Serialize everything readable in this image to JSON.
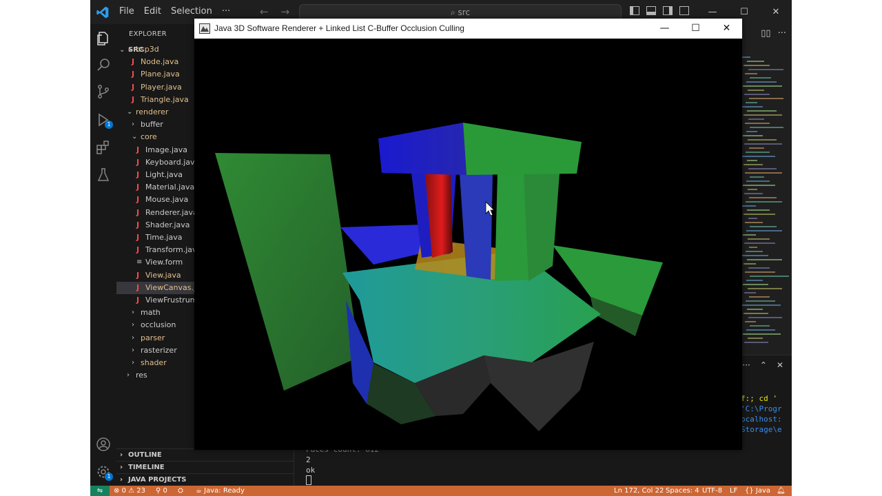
{
  "vscode": {
    "menu": [
      "File",
      "Edit",
      "Selection",
      "···"
    ],
    "search_text": "src",
    "explorer_title": "EXPLORER",
    "folder_root": "SRC",
    "tree": [
      {
        "label": "bsp3d",
        "type": "folder",
        "depth": 1,
        "open": true,
        "status": "mod"
      },
      {
        "label": "Node.java",
        "type": "java",
        "depth": 2,
        "status": "mod"
      },
      {
        "label": "Plane.java",
        "type": "java",
        "depth": 2,
        "status": "mod"
      },
      {
        "label": "Player.java",
        "type": "java",
        "depth": 2,
        "status": "mod"
      },
      {
        "label": "Triangle.java",
        "type": "java",
        "depth": 2,
        "status": "mod"
      },
      {
        "label": "renderer",
        "type": "folder",
        "depth": 1,
        "open": true,
        "status": "mod"
      },
      {
        "label": "buffer",
        "type": "folder",
        "depth": 2,
        "open": false,
        "status": ""
      },
      {
        "label": "core",
        "type": "folder",
        "depth": 2,
        "open": true,
        "status": "mod"
      },
      {
        "label": "Image.java",
        "type": "java",
        "depth": 3,
        "status": ""
      },
      {
        "label": "Keyboard.java",
        "type": "java",
        "depth": 3,
        "status": ""
      },
      {
        "label": "Light.java",
        "type": "java",
        "depth": 3,
        "status": ""
      },
      {
        "label": "Material.java",
        "type": "java",
        "depth": 3,
        "status": ""
      },
      {
        "label": "Mouse.java",
        "type": "java",
        "depth": 3,
        "status": ""
      },
      {
        "label": "Renderer.java",
        "type": "java",
        "depth": 3,
        "status": ""
      },
      {
        "label": "Shader.java",
        "type": "java",
        "depth": 3,
        "status": ""
      },
      {
        "label": "Time.java",
        "type": "java",
        "depth": 3,
        "status": ""
      },
      {
        "label": "Transform.java",
        "type": "java",
        "depth": 3,
        "status": ""
      },
      {
        "label": "View.form",
        "type": "form",
        "depth": 3,
        "status": ""
      },
      {
        "label": "View.java",
        "type": "java",
        "depth": 3,
        "status": "mod"
      },
      {
        "label": "ViewCanvas.java",
        "type": "java",
        "depth": 3,
        "status": "mod",
        "selected": true
      },
      {
        "label": "ViewFrustrumC",
        "type": "java",
        "depth": 3,
        "status": ""
      },
      {
        "label": "math",
        "type": "folder",
        "depth": 2,
        "open": false,
        "status": ""
      },
      {
        "label": "occlusion",
        "type": "folder",
        "depth": 2,
        "open": false,
        "status": ""
      },
      {
        "label": "parser",
        "type": "folder",
        "depth": 2,
        "open": false,
        "status": "mod"
      },
      {
        "label": "rasterizer",
        "type": "folder",
        "depth": 2,
        "open": false,
        "status": ""
      },
      {
        "label": "shader",
        "type": "folder",
        "depth": 2,
        "open": false,
        "status": "mod"
      },
      {
        "label": "res",
        "type": "folder",
        "depth": 1,
        "open": false,
        "status": ""
      }
    ],
    "sections": [
      "OUTLINE",
      "TIMELINE",
      "JAVA PROJECTS"
    ],
    "terminal": {
      "lines": [
        "Faces count: 612",
        "2",
        "ok"
      ],
      "side_lines": [
        "f:; cd '",
        "'C:\\Progr",
        "ocalhost:",
        "Storage\\e"
      ]
    },
    "status": {
      "errors": "0",
      "warnings": "23",
      "ports": "0",
      "java_state": "Java: Ready",
      "position": "Ln 172, Col 22",
      "spaces": "Spaces: 4",
      "encoding": "UTF-8",
      "eol": "LF",
      "language": "Java"
    },
    "badges": {
      "run": "1",
      "settings": "1"
    }
  },
  "app_window": {
    "title": "Java 3D Software Renderer + Linked List C-Buffer Occlusion Culling",
    "controls": {
      "minimize": "—",
      "maximize": "☐",
      "close": "✕"
    }
  },
  "colors": {
    "accent_status": "#cc6633",
    "remote": "#16825d",
    "scene_green": "#2f8f3a",
    "scene_blue": "#2424c8",
    "scene_red": "#d81e1e"
  }
}
